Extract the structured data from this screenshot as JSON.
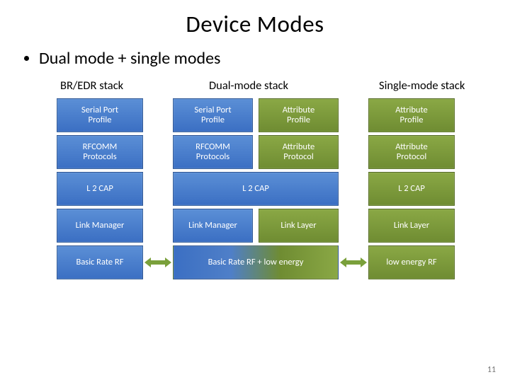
{
  "title": "Device Modes",
  "bullet1": "Dual mode + single modes",
  "labels": {
    "bredr": "BR/EDR stack",
    "dual": "Dual-mode stack",
    "single": "Single-mode stack"
  },
  "boxes": {
    "serial_port_profile": "Serial Port\nProfile",
    "attribute_profile": "Attribute\nProfile",
    "rfcomm_protocols": "RFCOMM\nProtocols",
    "attribute_protocol": "Attribute\nProtocol",
    "l2cap": "L 2 CAP",
    "link_manager": "Link Manager",
    "link_layer": "Link Layer",
    "basic_rate_rf": "Basic Rate RF",
    "basic_rate_rf_le": "Basic Rate RF + low energy",
    "low_energy_rf": "low energy RF"
  },
  "page_number": "11"
}
